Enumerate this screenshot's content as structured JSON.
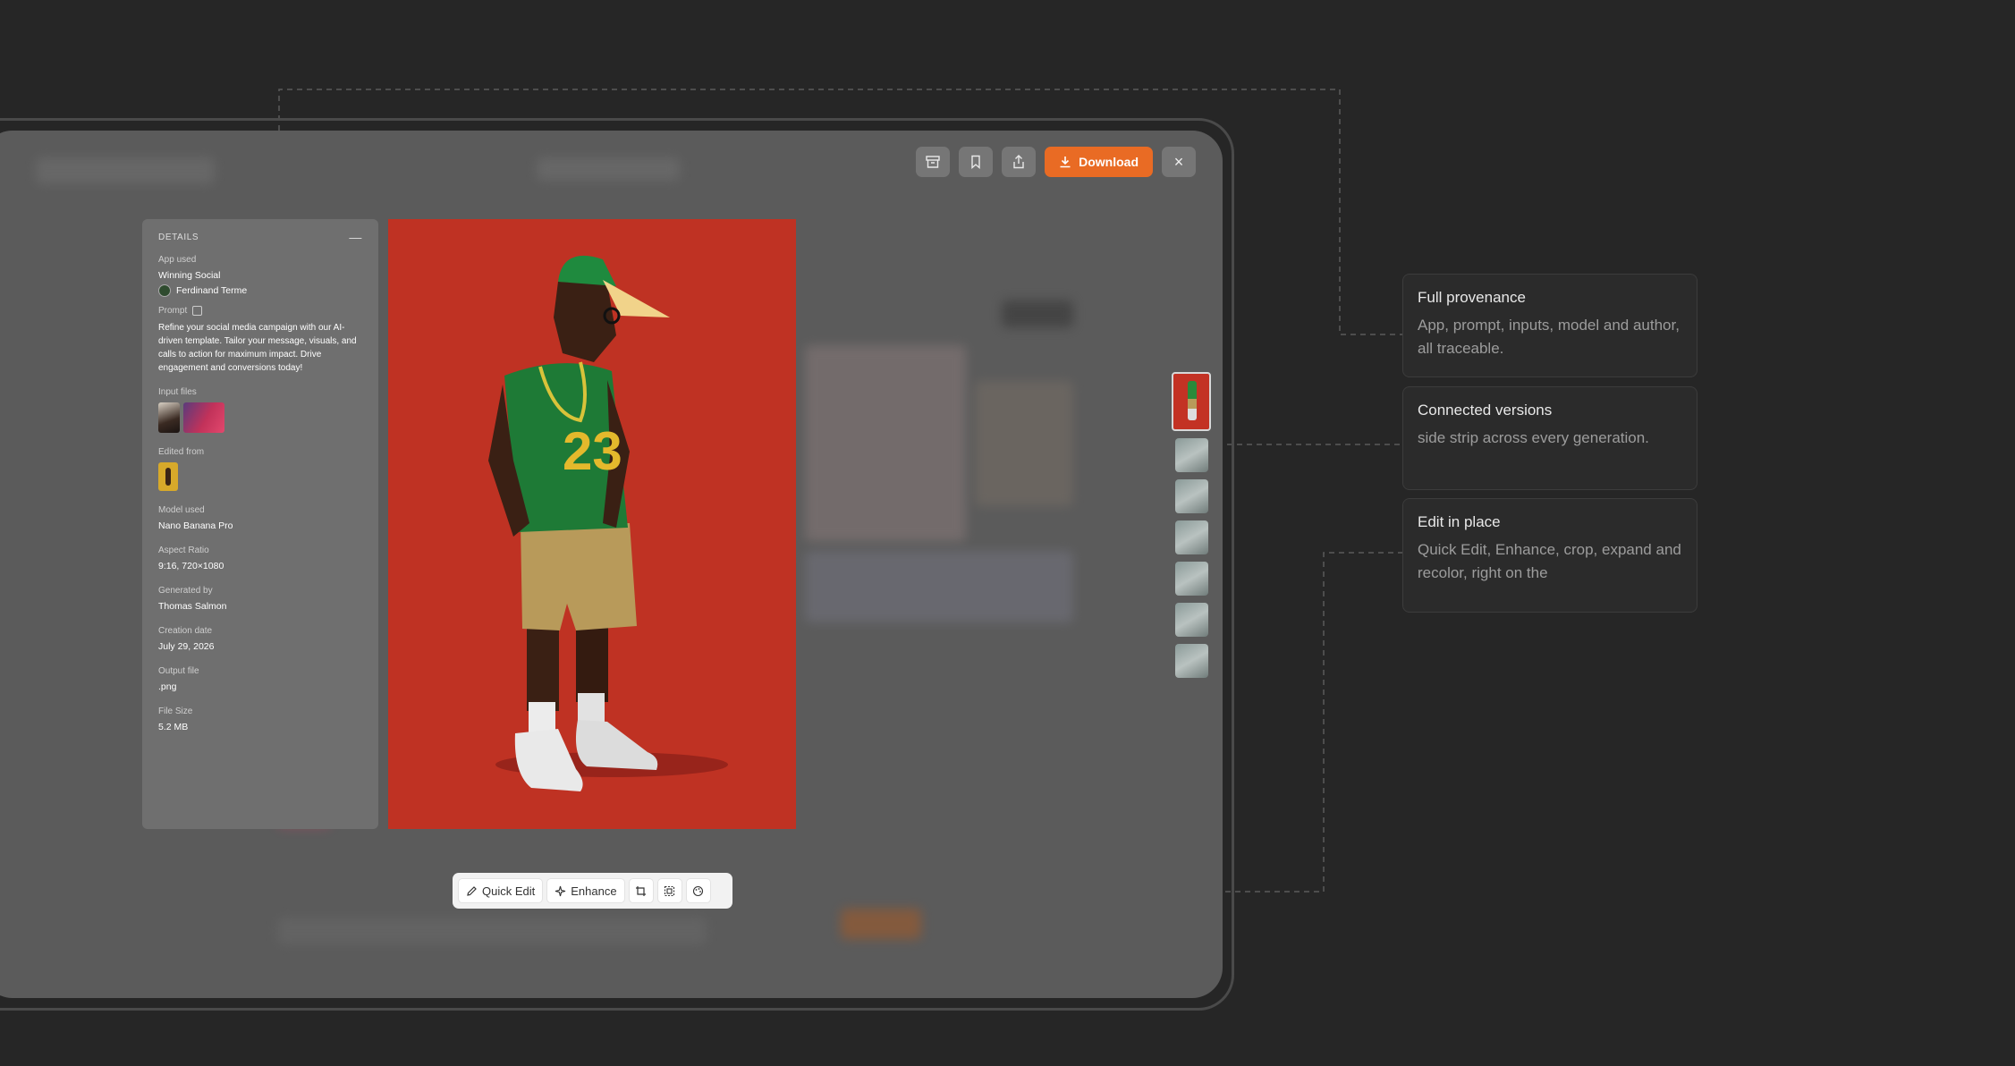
{
  "toolbar": {
    "archive_icon": "archive-icon",
    "bookmark_icon": "bookmark-icon",
    "share_icon": "share-icon",
    "download_label": "Download",
    "close_label": "×"
  },
  "details": {
    "title": "DETAILS",
    "minimize": "—",
    "app_used_label": "App used",
    "app_used": "Winning Social",
    "author": "Ferdinand Terme",
    "prompt_label": "Prompt",
    "prompt": "Refine your social media campaign with our AI-driven template. Tailor your message, visuals, and calls to action for maximum impact. Drive engagement and conversions today!",
    "input_files_label": "Input files",
    "edited_from_label": "Edited from",
    "model_used_label": "Model used",
    "model_used": "Nano Banana Pro",
    "aspect_ratio_label": "Aspect Ratio",
    "aspect_ratio": "9:16, 720×1080",
    "generated_by_label": "Generated by",
    "generated_by": "Thomas Salmon",
    "creation_date_label": "Creation date",
    "creation_date": "July 29, 2026",
    "output_file_label": "Output file",
    "output_file": ".png",
    "file_size_label": "File Size",
    "file_size": "5.2 MB"
  },
  "edit_bar": {
    "quick_edit": "Quick Edit",
    "enhance": "Enhance"
  },
  "cards": [
    {
      "title": "Full provenance",
      "desc": "App, prompt, inputs, model and author, all traceable."
    },
    {
      "title": "Connected versions",
      "desc": "side strip across every generation."
    },
    {
      "title": "Edit in place",
      "desc": "Quick Edit, Enhance, crop, expand and recolor, right on the"
    }
  ],
  "colors": {
    "accent": "#e96b24",
    "background": "#262626",
    "image_bg": "#bf3223"
  }
}
